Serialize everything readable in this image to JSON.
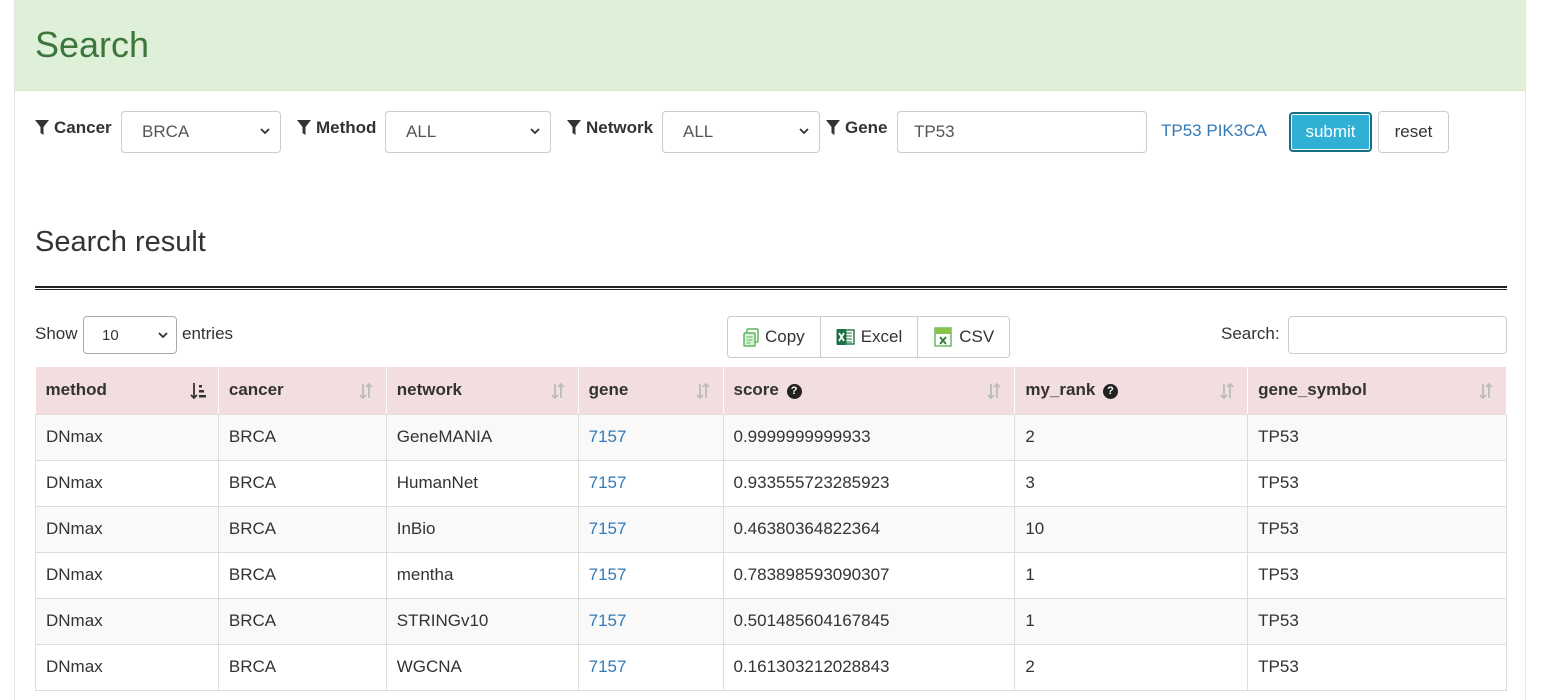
{
  "panel": {
    "title": "Search"
  },
  "filters": {
    "cancer": {
      "label": "Cancer",
      "value": "BRCA"
    },
    "method": {
      "label": "Method",
      "value": "ALL"
    },
    "network": {
      "label": "Network",
      "value": "ALL"
    },
    "gene": {
      "label": "Gene",
      "value": "TP53",
      "examples": "TP53 PIK3CA"
    },
    "submit_label": "submit",
    "reset_label": "reset"
  },
  "result": {
    "title": "Search result",
    "show_label": "Show",
    "page_length": "10",
    "entries_label": "entries",
    "buttons": {
      "copy": "Copy",
      "excel": "Excel",
      "csv": "CSV"
    },
    "search_label": "Search:"
  },
  "table": {
    "headers": [
      "method",
      "cancer",
      "network",
      "gene",
      "score",
      "my_rank",
      "gene_symbol"
    ],
    "rows": [
      [
        "DNmax",
        "BRCA",
        "GeneMANIA",
        "7157",
        "0.9999999999933",
        "2",
        "TP53"
      ],
      [
        "DNmax",
        "BRCA",
        "HumanNet",
        "7157",
        "0.933555723285923",
        "3",
        "TP53"
      ],
      [
        "DNmax",
        "BRCA",
        "InBio",
        "7157",
        "0.46380364822364",
        "10",
        "TP53"
      ],
      [
        "DNmax",
        "BRCA",
        "mentha",
        "7157",
        "0.783898593090307",
        "1",
        "TP53"
      ],
      [
        "DNmax",
        "BRCA",
        "STRINGv10",
        "7157",
        "0.501485604167845",
        "1",
        "TP53"
      ],
      [
        "DNmax",
        "BRCA",
        "WGCNA",
        "7157",
        "0.161303212028843",
        "2",
        "TP53"
      ]
    ]
  },
  "colors": {
    "heading_bg": "#dff0d8",
    "heading_text": "#3c763d",
    "table_header_bg": "#f2dede",
    "submit_bg": "#31b0d5",
    "link": "#337ab7"
  }
}
